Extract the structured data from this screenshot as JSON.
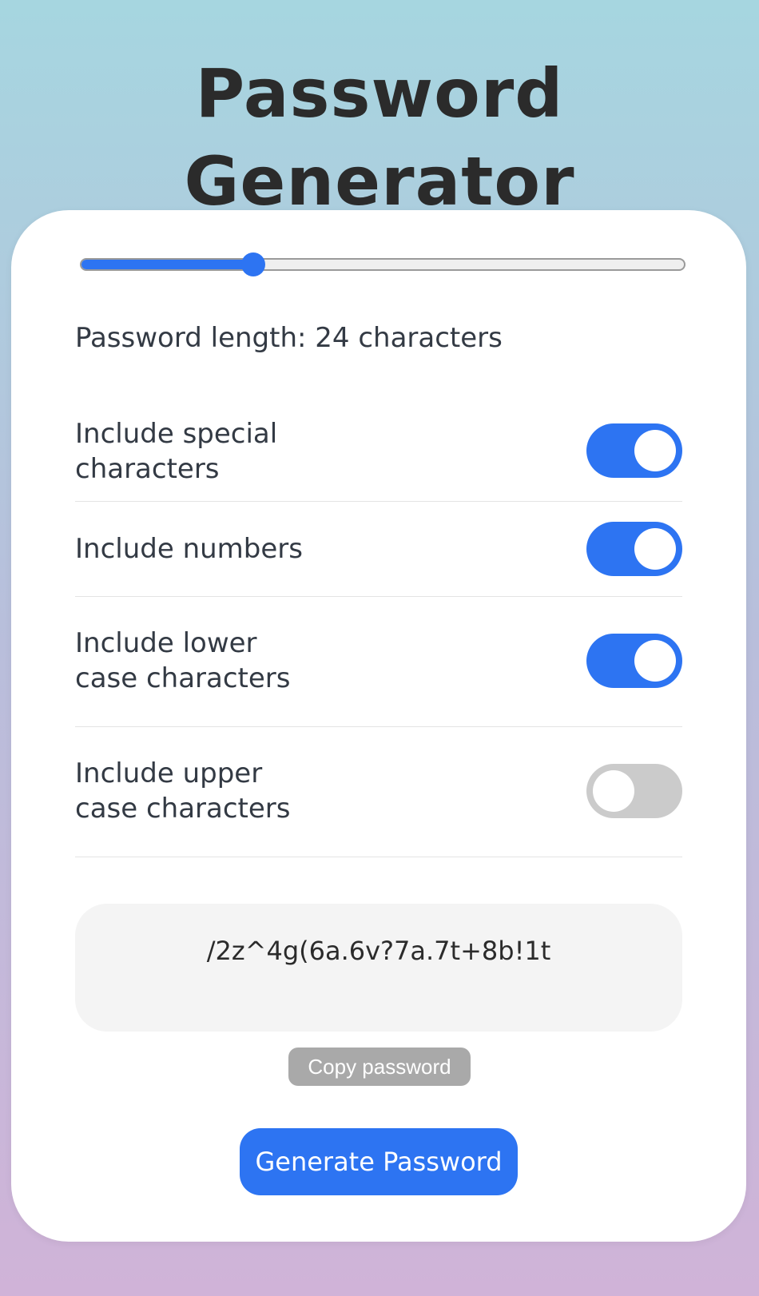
{
  "page": {
    "title": "Password Generator"
  },
  "slider": {
    "min": 8,
    "max": 64,
    "value": 24,
    "accent_color": "#2d74f2"
  },
  "length_label": "Password length: 24 characters",
  "options": [
    {
      "label": "Include special\ncharacters",
      "enabled": true
    },
    {
      "label": "Include numbers",
      "enabled": true
    },
    {
      "label": "Include lower\ncase characters",
      "enabled": true
    },
    {
      "label": "Include upper\ncase characters",
      "enabled": false
    }
  ],
  "password": {
    "value": "/2z^4g(6a.6v?7a.7t+8b!1t"
  },
  "buttons": {
    "copy_label": "Copy password",
    "generate_label": "Generate Password"
  },
  "colors": {
    "accent": "#2d74f2",
    "toggle_off": "#cbcbcb",
    "copy_button": "#a9a9a9"
  }
}
